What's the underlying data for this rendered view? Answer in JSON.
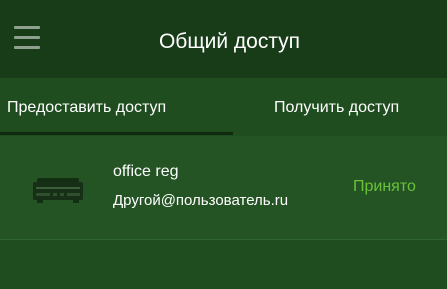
{
  "appbar": {
    "title": "Общий доступ",
    "menu_icon": "hamburger-menu-icon"
  },
  "tabs": [
    {
      "label": "Предоставить доступ",
      "active": true
    },
    {
      "label": "Получить доступ",
      "active": false
    }
  ],
  "shares": [
    {
      "name": "office reg",
      "user": "Другой@пользователь.ru",
      "status": "Принято",
      "icon": "dvr-device-icon"
    }
  ],
  "colors": {
    "appbar_bg": "#183b18",
    "content_bg": "#1f4d1f",
    "row_bg": "#245424",
    "status_accepted": "#6ac23a",
    "tab_indicator": "#0f2a0f"
  }
}
